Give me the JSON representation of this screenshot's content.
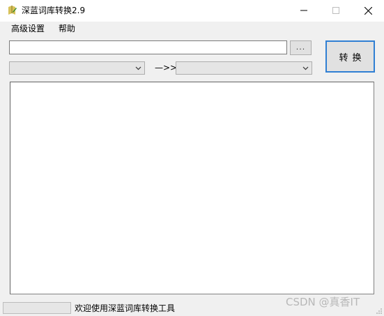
{
  "window": {
    "title": "深蓝词库转换2.9",
    "icon": "book-pencil-icon",
    "controls": [
      "minimize-icon",
      "maximize-icon",
      "close-icon"
    ]
  },
  "menu": {
    "advanced_settings": "高级设置",
    "help": "帮助"
  },
  "toolbar": {
    "path_value": "",
    "browse_label": "...",
    "from_format_value": "",
    "arrow_label": "—>>",
    "to_format_value": "",
    "convert_label": "转换"
  },
  "status": {
    "progress": 0,
    "message": "欢迎使用深蓝词库转换工具"
  },
  "watermark": "CSDN @真香IT",
  "colors": {
    "window_bg": "#f0f0f0",
    "titlebar_bg": "#ffffff",
    "button_focus_border": "#2f7fd3",
    "progress_fill": "#06b025"
  }
}
